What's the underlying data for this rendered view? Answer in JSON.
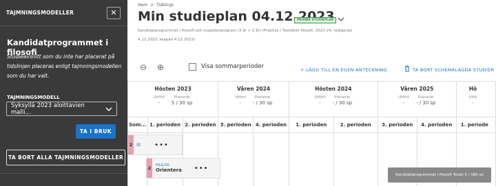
{
  "sidebar": {
    "header_title": "TAJMNINGSMODELLER",
    "close_icon": "✕",
    "title": "Kandidatprogrammet i filosofi",
    "description": "Studieavsnitt som du inte har placerat på tidslinjen placeras enligt tajmningsmodellen som du har valt.",
    "select_label": "TAJMNINGSMODELL",
    "select_value": "Syksyllä 2023 aloittavien malli...",
    "ok_button": "TA I BRUK",
    "remove_all_button": "TA BORT ALLA TAJMNINGSMODELLER"
  },
  "breadcrumb": {
    "home": "Hem",
    "sep": ">",
    "current": "Tidslinje"
  },
  "page": {
    "title": "Min studieplan 04.12.2023",
    "badge": "PRIMÄR STUDIEPLAN",
    "subtitle1": "Kandidatprogrammet i filosofi och magisterprogram (3 år + 2 år) (Praktisk / Teoretisk filosofi, 2023-24, redigerad",
    "subtitle2": "4.12.2023, skapad 4.12.2023)"
  },
  "toolbar": {
    "zoom_out_icon": "⊖",
    "zoom_in_icon": "⊕",
    "summer_label": "Visa sommarperioder",
    "add_note": "+ LÄGG TILL EN EGEN ANTECKNING",
    "delete_schedules": "TA BORT SCHEMALAGDA STUDIER"
  },
  "table": {
    "stat_labels": {
      "done": "Utfört",
      "planned": "Planerat"
    },
    "semesters": [
      {
        "name": "Hösten 2023",
        "done": "-",
        "planned": "5 / 30 sp"
      },
      {
        "name": "Våren 2024",
        "done": "-",
        "planned": "- / 30 sp"
      },
      {
        "name": "Hösten 2024",
        "done": "-",
        "planned": "- / 30 sp"
      },
      {
        "name": "Våren 2025",
        "done": "-",
        "planned": "- / 30 sp"
      },
      {
        "name": "Hö",
        "done": "Utfö",
        "planned": "-"
      }
    ],
    "periods": [
      "Som...",
      "1. perioden",
      "2. perioden",
      "3. perioden",
      "4. perioden",
      "1. perioden",
      "2. perioden",
      "3. perioden",
      "4. perioden",
      "1. periode"
    ]
  },
  "cards": {
    "row1_num": "2",
    "row1_code": "St",
    "row1_dots": "•••",
    "row2_num": "2",
    "row2_code": "FILK-00",
    "row2_title": "Orientera",
    "row2_dots": "•••"
  },
  "tooltip": "Kandidatprogrammet i filosofi Totalt 5 / 180 sp"
}
